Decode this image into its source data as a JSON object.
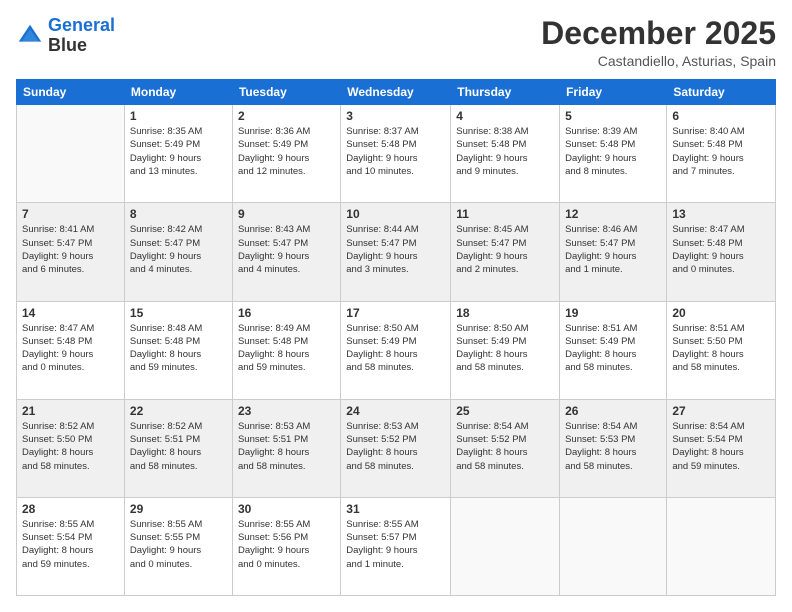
{
  "logo": {
    "line1": "General",
    "line2": "Blue"
  },
  "title": "December 2025",
  "subtitle": "Castandiello, Asturias, Spain",
  "weekdays": [
    "Sunday",
    "Monday",
    "Tuesday",
    "Wednesday",
    "Thursday",
    "Friday",
    "Saturday"
  ],
  "weeks": [
    [
      {
        "day": "",
        "info": ""
      },
      {
        "day": "1",
        "info": "Sunrise: 8:35 AM\nSunset: 5:49 PM\nDaylight: 9 hours\nand 13 minutes."
      },
      {
        "day": "2",
        "info": "Sunrise: 8:36 AM\nSunset: 5:49 PM\nDaylight: 9 hours\nand 12 minutes."
      },
      {
        "day": "3",
        "info": "Sunrise: 8:37 AM\nSunset: 5:48 PM\nDaylight: 9 hours\nand 10 minutes."
      },
      {
        "day": "4",
        "info": "Sunrise: 8:38 AM\nSunset: 5:48 PM\nDaylight: 9 hours\nand 9 minutes."
      },
      {
        "day": "5",
        "info": "Sunrise: 8:39 AM\nSunset: 5:48 PM\nDaylight: 9 hours\nand 8 minutes."
      },
      {
        "day": "6",
        "info": "Sunrise: 8:40 AM\nSunset: 5:48 PM\nDaylight: 9 hours\nand 7 minutes."
      }
    ],
    [
      {
        "day": "7",
        "info": "Sunrise: 8:41 AM\nSunset: 5:47 PM\nDaylight: 9 hours\nand 6 minutes."
      },
      {
        "day": "8",
        "info": "Sunrise: 8:42 AM\nSunset: 5:47 PM\nDaylight: 9 hours\nand 4 minutes."
      },
      {
        "day": "9",
        "info": "Sunrise: 8:43 AM\nSunset: 5:47 PM\nDaylight: 9 hours\nand 4 minutes."
      },
      {
        "day": "10",
        "info": "Sunrise: 8:44 AM\nSunset: 5:47 PM\nDaylight: 9 hours\nand 3 minutes."
      },
      {
        "day": "11",
        "info": "Sunrise: 8:45 AM\nSunset: 5:47 PM\nDaylight: 9 hours\nand 2 minutes."
      },
      {
        "day": "12",
        "info": "Sunrise: 8:46 AM\nSunset: 5:47 PM\nDaylight: 9 hours\nand 1 minute."
      },
      {
        "day": "13",
        "info": "Sunrise: 8:47 AM\nSunset: 5:48 PM\nDaylight: 9 hours\nand 0 minutes."
      }
    ],
    [
      {
        "day": "14",
        "info": "Sunrise: 8:47 AM\nSunset: 5:48 PM\nDaylight: 9 hours\nand 0 minutes."
      },
      {
        "day": "15",
        "info": "Sunrise: 8:48 AM\nSunset: 5:48 PM\nDaylight: 8 hours\nand 59 minutes."
      },
      {
        "day": "16",
        "info": "Sunrise: 8:49 AM\nSunset: 5:48 PM\nDaylight: 8 hours\nand 59 minutes."
      },
      {
        "day": "17",
        "info": "Sunrise: 8:50 AM\nSunset: 5:49 PM\nDaylight: 8 hours\nand 58 minutes."
      },
      {
        "day": "18",
        "info": "Sunrise: 8:50 AM\nSunset: 5:49 PM\nDaylight: 8 hours\nand 58 minutes."
      },
      {
        "day": "19",
        "info": "Sunrise: 8:51 AM\nSunset: 5:49 PM\nDaylight: 8 hours\nand 58 minutes."
      },
      {
        "day": "20",
        "info": "Sunrise: 8:51 AM\nSunset: 5:50 PM\nDaylight: 8 hours\nand 58 minutes."
      }
    ],
    [
      {
        "day": "21",
        "info": "Sunrise: 8:52 AM\nSunset: 5:50 PM\nDaylight: 8 hours\nand 58 minutes."
      },
      {
        "day": "22",
        "info": "Sunrise: 8:52 AM\nSunset: 5:51 PM\nDaylight: 8 hours\nand 58 minutes."
      },
      {
        "day": "23",
        "info": "Sunrise: 8:53 AM\nSunset: 5:51 PM\nDaylight: 8 hours\nand 58 minutes."
      },
      {
        "day": "24",
        "info": "Sunrise: 8:53 AM\nSunset: 5:52 PM\nDaylight: 8 hours\nand 58 minutes."
      },
      {
        "day": "25",
        "info": "Sunrise: 8:54 AM\nSunset: 5:52 PM\nDaylight: 8 hours\nand 58 minutes."
      },
      {
        "day": "26",
        "info": "Sunrise: 8:54 AM\nSunset: 5:53 PM\nDaylight: 8 hours\nand 58 minutes."
      },
      {
        "day": "27",
        "info": "Sunrise: 8:54 AM\nSunset: 5:54 PM\nDaylight: 8 hours\nand 59 minutes."
      }
    ],
    [
      {
        "day": "28",
        "info": "Sunrise: 8:55 AM\nSunset: 5:54 PM\nDaylight: 8 hours\nand 59 minutes."
      },
      {
        "day": "29",
        "info": "Sunrise: 8:55 AM\nSunset: 5:55 PM\nDaylight: 9 hours\nand 0 minutes."
      },
      {
        "day": "30",
        "info": "Sunrise: 8:55 AM\nSunset: 5:56 PM\nDaylight: 9 hours\nand 0 minutes."
      },
      {
        "day": "31",
        "info": "Sunrise: 8:55 AM\nSunset: 5:57 PM\nDaylight: 9 hours\nand 1 minute."
      },
      {
        "day": "",
        "info": ""
      },
      {
        "day": "",
        "info": ""
      },
      {
        "day": "",
        "info": ""
      }
    ]
  ]
}
